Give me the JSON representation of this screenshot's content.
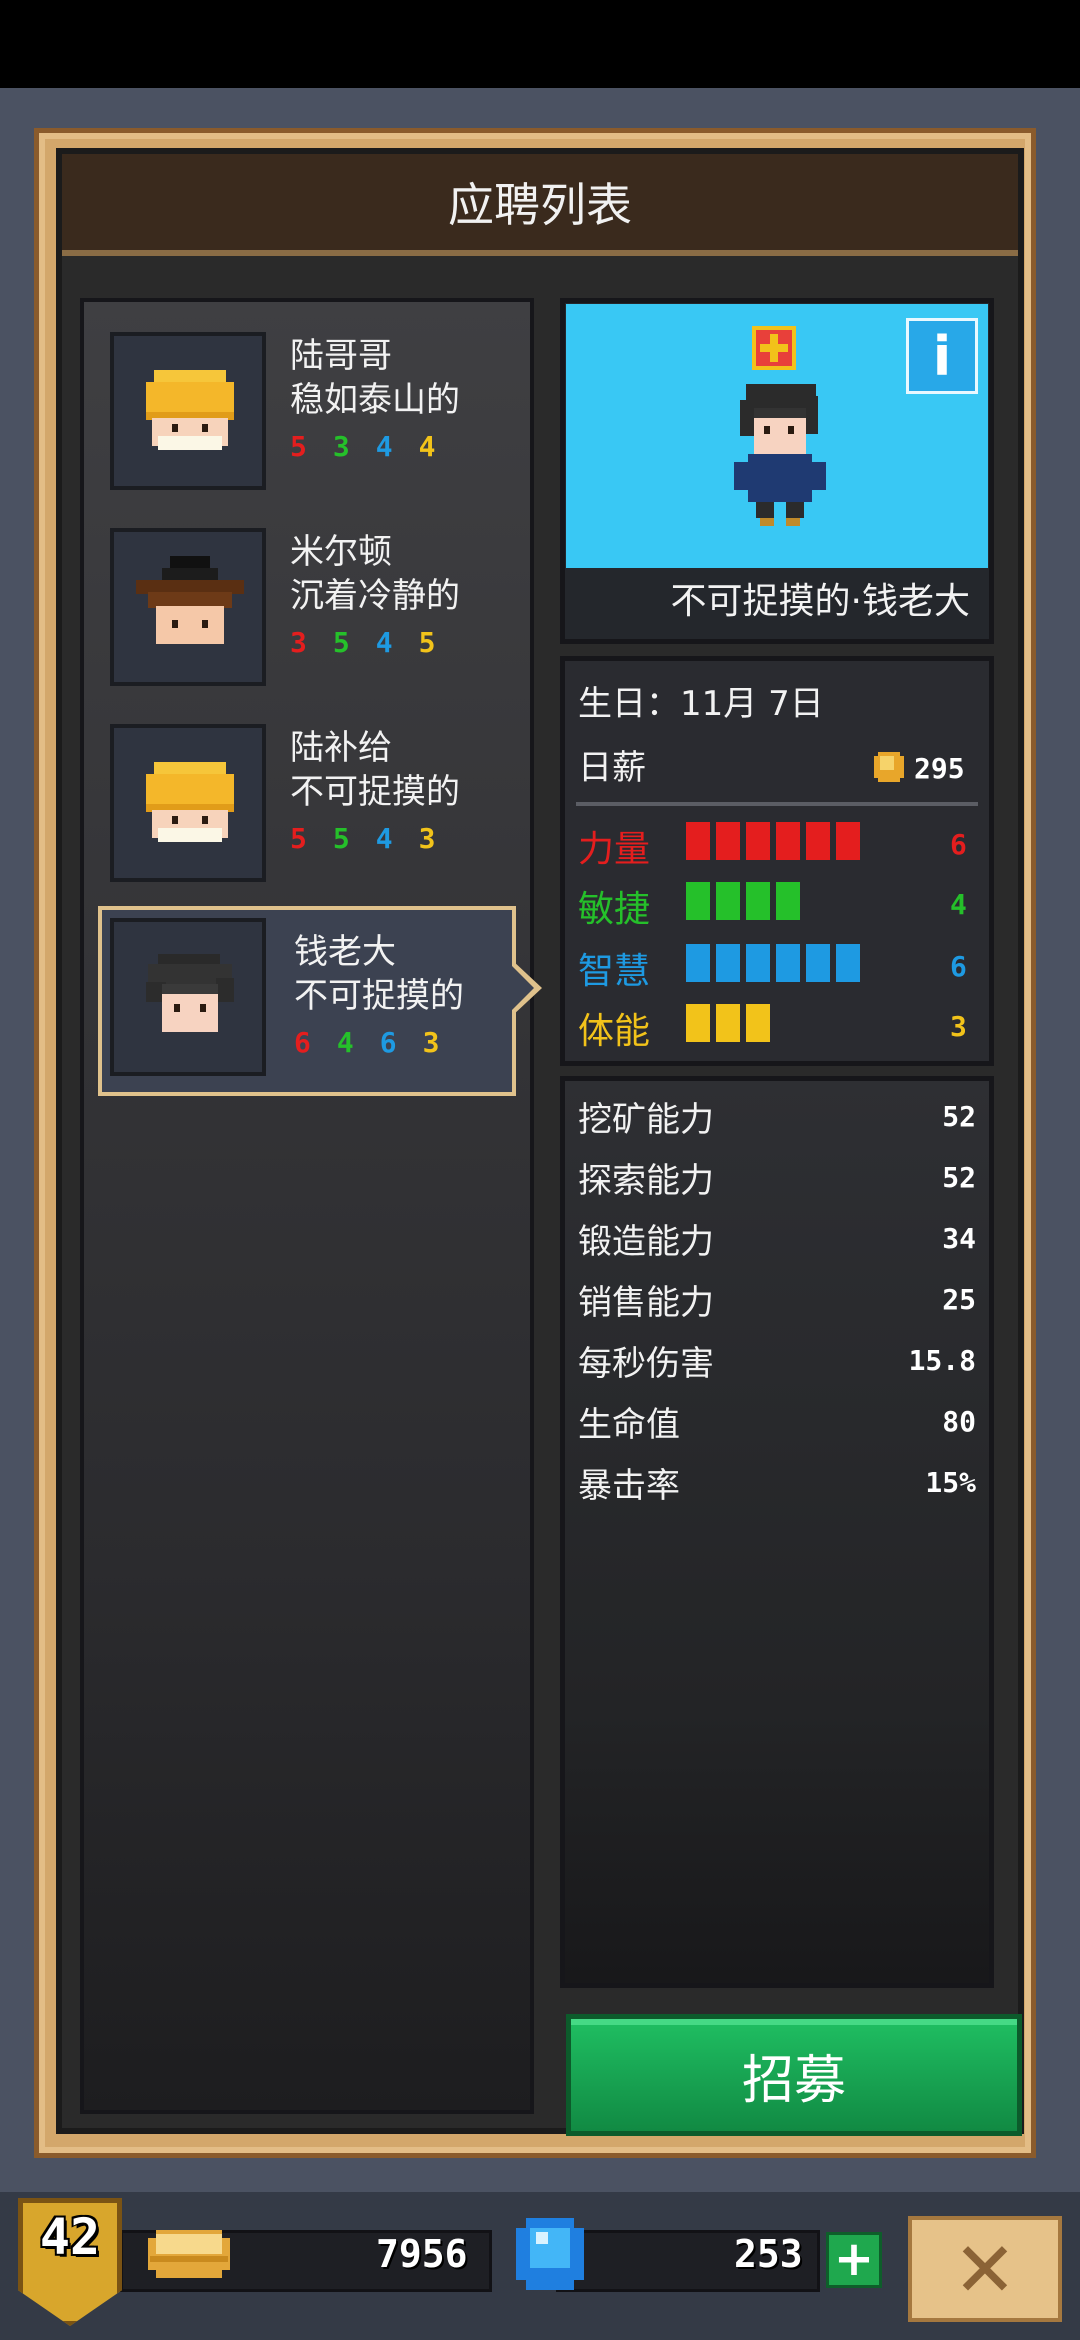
{
  "title": "应聘列表",
  "applicants": [
    {
      "name": "陆哥哥",
      "trait": "稳如泰山的",
      "stats": {
        "str": "5",
        "agi": "3",
        "int": "4",
        "sta": "4"
      },
      "hair": "blonde-helmet"
    },
    {
      "name": "米尔顿",
      "trait": "沉着冷静的",
      "stats": {
        "str": "3",
        "agi": "5",
        "int": "4",
        "sta": "5"
      },
      "hair": "black-hat"
    },
    {
      "name": "陆补给",
      "trait": "不可捉摸的",
      "stats": {
        "str": "5",
        "agi": "5",
        "int": "4",
        "sta": "3"
      },
      "hair": "blonde-helmet"
    },
    {
      "name": "钱老大",
      "trait": "不可捉摸的",
      "stats": {
        "str": "6",
        "agi": "4",
        "int": "6",
        "sta": "3"
      },
      "hair": "black-messy"
    }
  ],
  "selected": {
    "full_name": "不可捉摸的·钱老大",
    "birthday": "生日：11月 7日",
    "salary_label": "日薪",
    "salary": "295",
    "attributes": [
      {
        "label": "力量",
        "value": "6",
        "level": 6,
        "color": "#e41e1e"
      },
      {
        "label": "敏捷",
        "value": "4",
        "level": 4,
        "color": "#25c02a"
      },
      {
        "label": "智慧",
        "value": "6",
        "level": 6,
        "color": "#1e9ae2"
      },
      {
        "label": "体能",
        "value": "3",
        "level": 3,
        "color": "#f2c31a"
      }
    ],
    "abilities": [
      {
        "label": "挖矿能力",
        "value": "52"
      },
      {
        "label": "探索能力",
        "value": "52"
      },
      {
        "label": "锻造能力",
        "value": "34"
      },
      {
        "label": "销售能力",
        "value": "25"
      },
      {
        "label": "每秒伤害",
        "value": "15.8"
      },
      {
        "label": "生命值",
        "value": "80"
      },
      {
        "label": "暴击率",
        "value": "15%"
      }
    ]
  },
  "info_icon": "i",
  "recruit_label": "招募",
  "player": {
    "level": "42",
    "gold": "7956",
    "gems": "253"
  },
  "add_label": "+",
  "close_label": "✕"
}
